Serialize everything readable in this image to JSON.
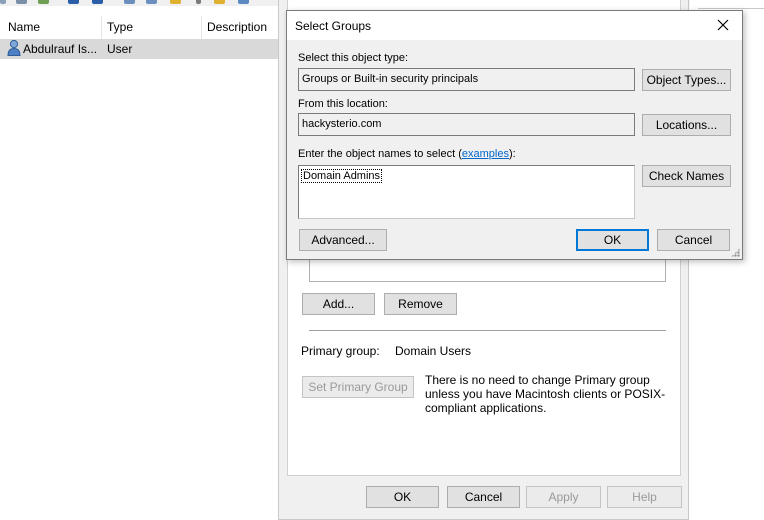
{
  "console": {
    "columns": {
      "name": "Name",
      "type": "Type",
      "description": "Description"
    },
    "rows": [
      {
        "name": "Abdulrauf Is...",
        "type": "User",
        "icon": "user-icon"
      }
    ]
  },
  "properties_dialog": {
    "member_of_buttons": {
      "add": "Add...",
      "remove": "Remove"
    },
    "primary_group_label": "Primary group:",
    "primary_group_value": "Domain Users",
    "set_primary_group": "Set Primary Group",
    "info_text": "There is no need to change Primary group unless you have Macintosh clients or POSIX-compliant applications.",
    "footer": {
      "ok": "OK",
      "cancel": "Cancel",
      "apply": "Apply",
      "help": "Help"
    }
  },
  "select_groups": {
    "title": "Select Groups",
    "object_type_label": "Select this object type:",
    "object_type_value": "Groups or Built-in security principals",
    "object_types_button": "Object Types...",
    "location_label": "From this location:",
    "location_value": "hackysterio.com",
    "locations_button": "Locations...",
    "names_label_prefix": "Enter the object names to select (",
    "names_label_link": "examples",
    "names_label_suffix": "):",
    "names_value": "Domain Admins",
    "check_names_button": "Check Names",
    "advanced_button": "Advanced...",
    "ok_button": "OK",
    "cancel_button": "Cancel"
  },
  "colors": {
    "dialog_bg": "#f0f0f0",
    "accent": "#0078d7",
    "link": "#0066cc",
    "selection": "#d9d9d9"
  }
}
